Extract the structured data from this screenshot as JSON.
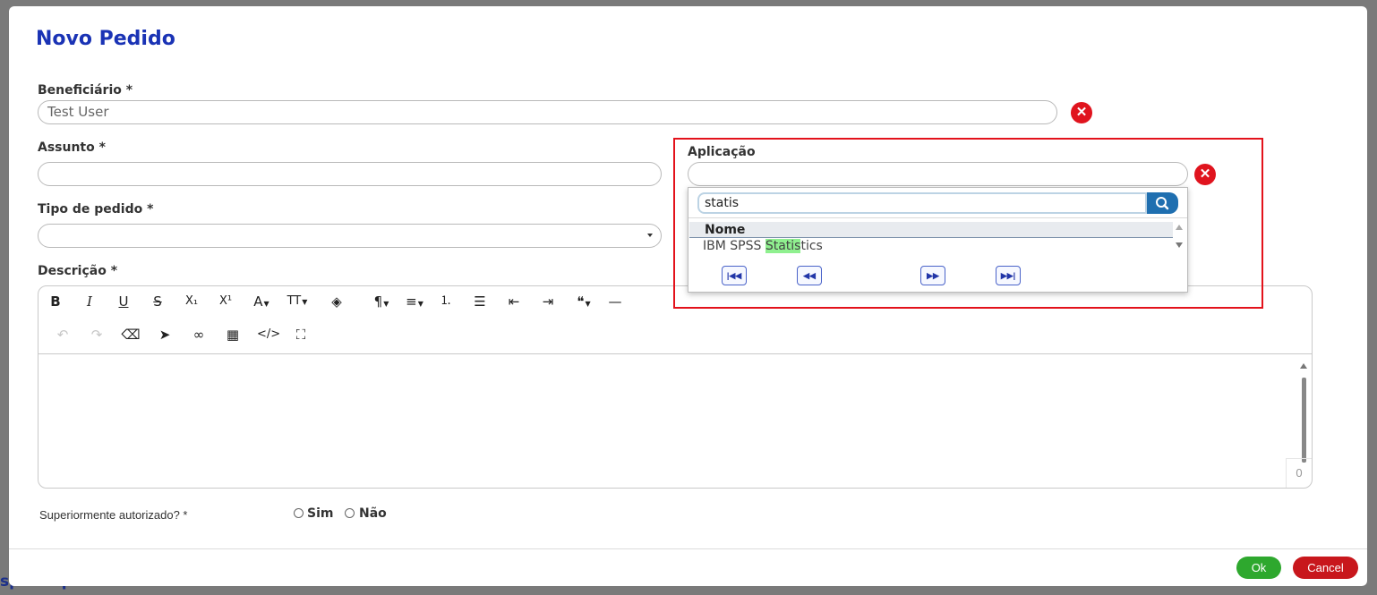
{
  "background": {
    "partial_text": "specifique o tema."
  },
  "modal": {
    "title": "Novo Pedido",
    "beneficiario": {
      "label": "Beneficiário *",
      "value": "Test User"
    },
    "assunto": {
      "label": "Assunto *",
      "value": ""
    },
    "tipo_pedido": {
      "label": "Tipo de pedido *",
      "value": ""
    },
    "aplicacao": {
      "label": "Aplicação",
      "value": ""
    },
    "descricao": {
      "label": "Descrição *",
      "char_count": "0"
    },
    "toolbar_row1": [
      "bold-icon",
      "italic-icon",
      "underline-icon",
      "strikethrough-icon",
      "subscript-icon",
      "superscript-icon",
      "font-color-icon",
      "font-size-icon",
      "paint-bucket-icon",
      "paragraph-icon",
      "align-icon",
      "ordered-list-icon",
      "unordered-list-icon",
      "outdent-icon",
      "indent-icon",
      "quote-icon",
      "horizontal-rule-icon"
    ],
    "toolbar_row2": [
      "undo-icon",
      "redo-icon",
      "eraser-icon",
      "cursor-icon",
      "link-icon",
      "table-icon",
      "code-icon",
      "fullscreen-icon"
    ],
    "autorizado": {
      "label": "Superiormente autorizado?  *",
      "options": [
        "Sim",
        "Não"
      ]
    },
    "buttons": {
      "ok": "Ok",
      "cancel": "Cancel"
    }
  },
  "dropdown": {
    "search_value": "statis",
    "column_header": "Nome",
    "results": [
      {
        "prefix": "IBM SPSS ",
        "match": "Statis",
        "suffix": "tics"
      }
    ],
    "pager": [
      "first-page-icon",
      "prev-page-icon",
      "next-page-icon",
      "last-page-icon"
    ]
  },
  "colors": {
    "title": "#1a33b5",
    "danger": "#e0141e",
    "ok": "#2ea82e",
    "cancel": "#c8171c",
    "highlight_box": "#e3121b",
    "match_highlight": "#8ff08f"
  }
}
